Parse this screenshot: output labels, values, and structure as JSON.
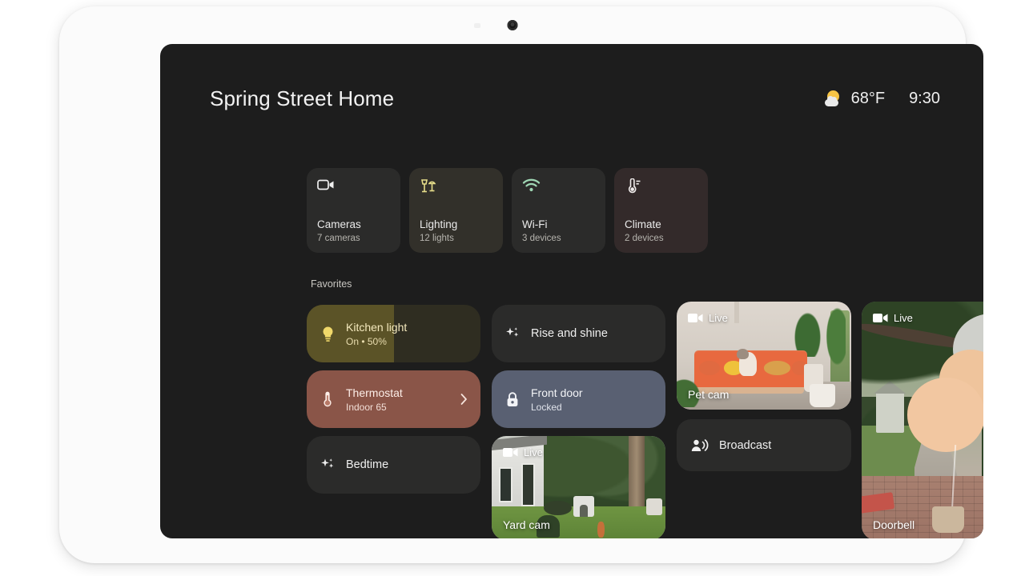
{
  "device": {
    "camera_icon": "front-camera-lens",
    "sensor_icon": "ambient-light-sensor"
  },
  "header": {
    "home_title": "Spring Street Home",
    "weather": {
      "icon": "sun-behind-cloud-icon",
      "temperature": "68°F"
    },
    "time": "9:30"
  },
  "quick_tiles": [
    {
      "icon": "video-camera-icon",
      "label": "Cameras",
      "sub": "7 cameras",
      "style": "default"
    },
    {
      "icon": "lamps-icon",
      "label": "Lighting",
      "sub": "12 lights",
      "style": "lighting"
    },
    {
      "icon": "wifi-icon",
      "label": "Wi-Fi",
      "sub": "3 devices",
      "style": "default"
    },
    {
      "icon": "thermometer-icon",
      "label": "Climate",
      "sub": "2 devices",
      "style": "climate"
    }
  ],
  "favorites": {
    "section_label": "Favorites",
    "kitchen_light": {
      "icon": "lightbulb-icon",
      "name": "Kitchen light",
      "state": "On • 50%",
      "brightness_percent": 50
    },
    "thermostat": {
      "icon": "thermostat-icon",
      "name": "Thermostat",
      "state": "Indoor 65",
      "chevron": "chevron-right-icon"
    },
    "bedtime": {
      "icon": "sparkles-icon",
      "name": "Bedtime"
    },
    "rise_and_shine": {
      "icon": "sparkles-icon",
      "name": "Rise and shine"
    },
    "front_door": {
      "icon": "lock-closed-icon",
      "name": "Front door",
      "state": "Locked"
    },
    "broadcast": {
      "icon": "broadcast-icon",
      "name": "Broadcast"
    }
  },
  "cameras": [
    {
      "name": "Pet cam",
      "live_badge": "Live",
      "badge_icon": "video-camera-filled-icon"
    },
    {
      "name": "Yard cam",
      "live_badge": "Live",
      "badge_icon": "video-camera-filled-icon"
    },
    {
      "name": "Doorbell",
      "live_badge": "Live",
      "badge_icon": "video-camera-filled-icon"
    }
  ],
  "colors": {
    "screen_background": "#1d1d1d",
    "tile_default": "#2b2b2a",
    "lighting_tile": "#32302a",
    "climate_tile": "#332a2a",
    "kitchen_light_fill": "#5b5327",
    "kitchen_light_track": "#2f2d21",
    "thermostat_tile": "#8a5548",
    "front_door_tile": "#596072",
    "lighting_accent": "#e6dd8a",
    "wifi_accent": "#9fd7b4",
    "weather_accent": "#f6c445",
    "bezel": "#fbfbfb"
  }
}
